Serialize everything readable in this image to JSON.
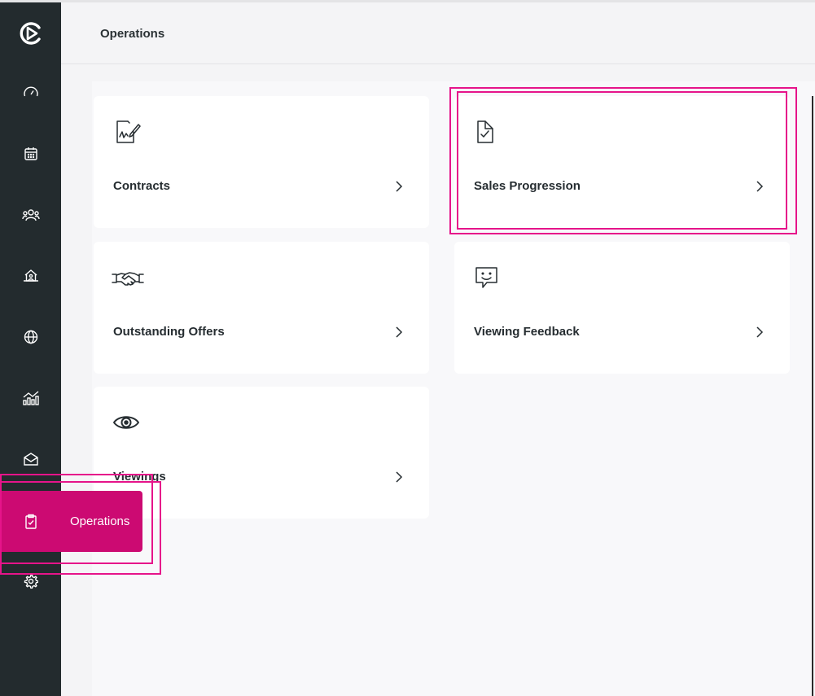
{
  "header": {
    "title": "Operations"
  },
  "sidebar": {
    "items": [
      {
        "name": "dashboard",
        "icon": "speedometer-icon"
      },
      {
        "name": "calendar",
        "icon": "calendar-icon"
      },
      {
        "name": "people",
        "icon": "people-icon"
      },
      {
        "name": "properties",
        "icon": "house-icon"
      },
      {
        "name": "web",
        "icon": "globe-icon"
      },
      {
        "name": "reports",
        "icon": "chart-icon"
      },
      {
        "name": "inbox",
        "icon": "inbox-icon"
      },
      {
        "name": "operations",
        "icon": "clipboard-check-icon",
        "label": "Operations",
        "active": true
      },
      {
        "name": "settings",
        "icon": "gear-icon"
      }
    ]
  },
  "cards": [
    {
      "label": "Contracts",
      "icon": "contract-signature-icon"
    },
    {
      "label": "Sales Progression",
      "icon": "document-check-icon"
    },
    {
      "label": "Outstanding Offers",
      "icon": "handshake-icon"
    },
    {
      "label": "Viewing Feedback",
      "icon": "speech-smile-icon"
    },
    {
      "label": "Viewings",
      "icon": "eye-icon"
    }
  ],
  "colors": {
    "accent": "#cc0a72",
    "highlight": "#e6148a",
    "sidebar": "#232b2e"
  }
}
